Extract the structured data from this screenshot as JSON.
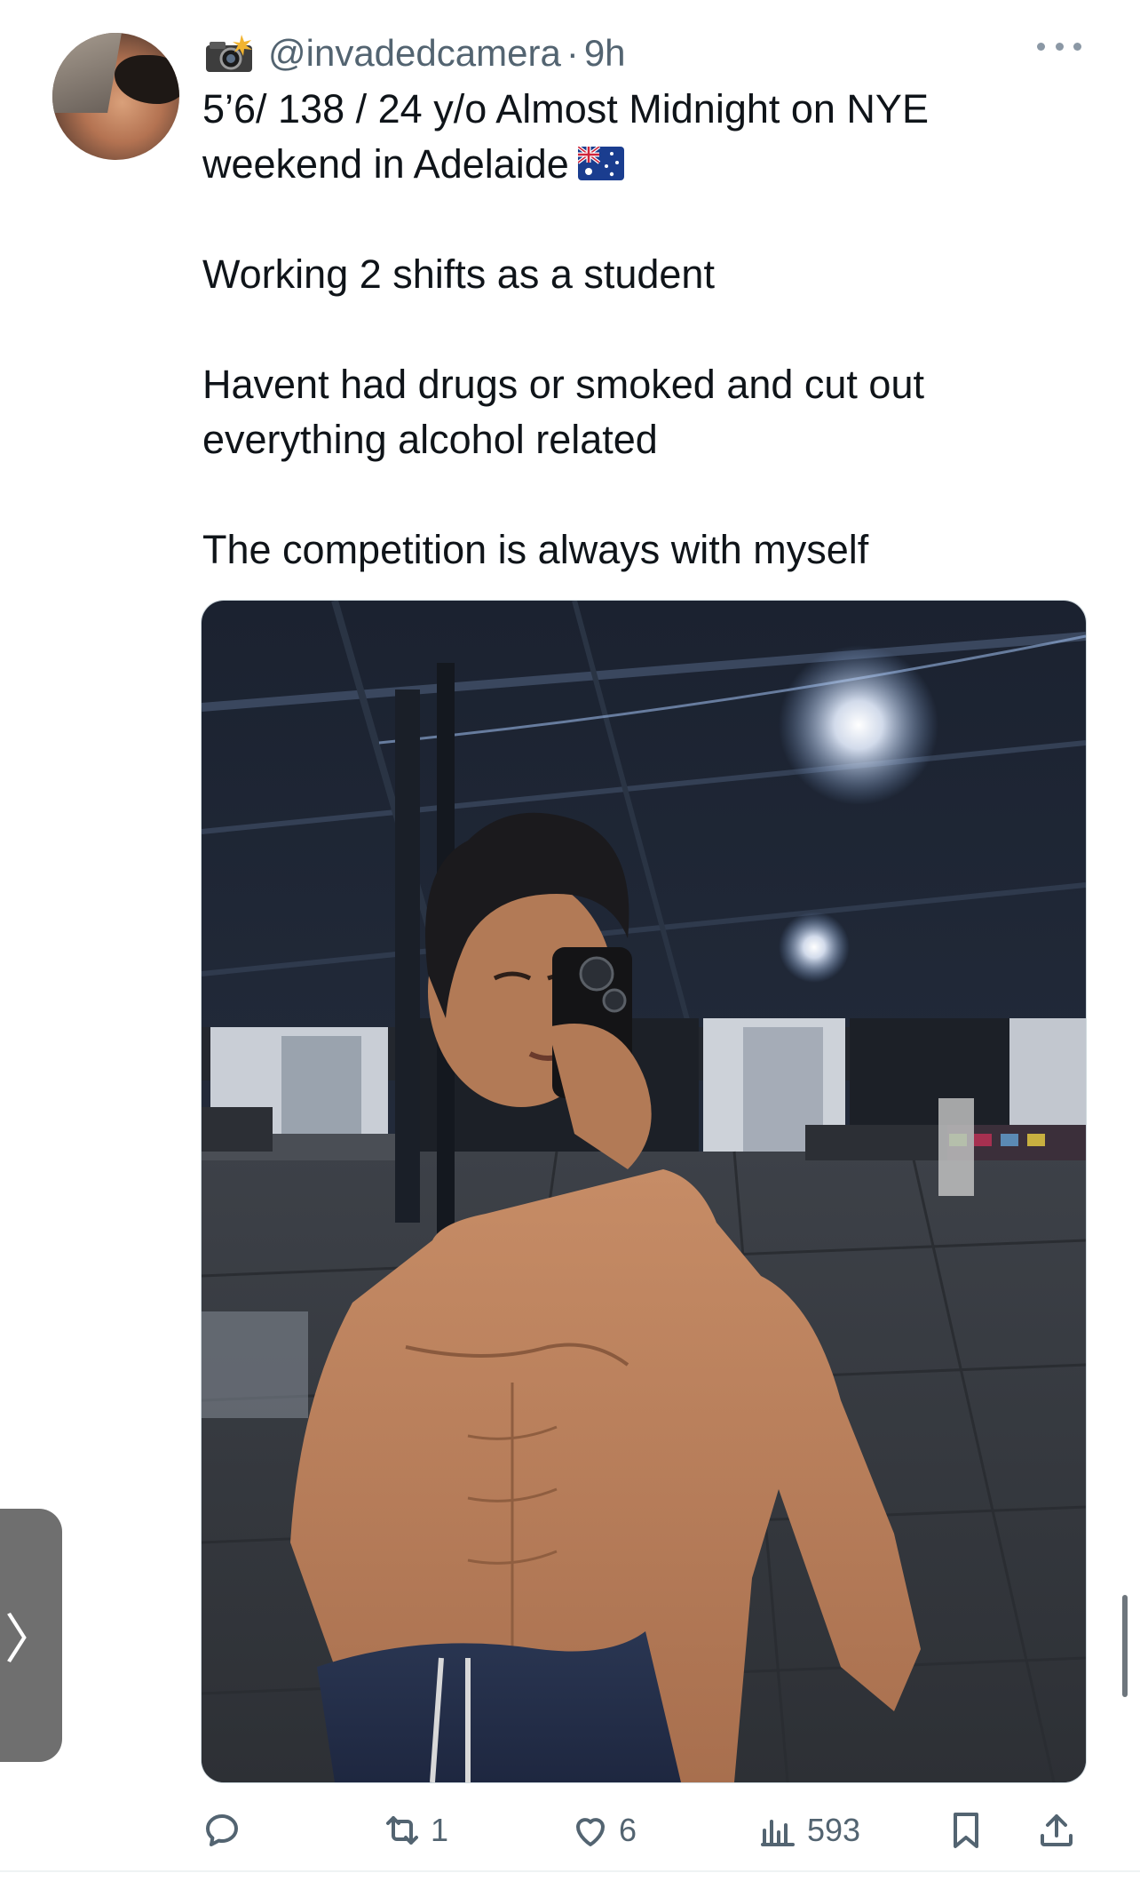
{
  "tweet": {
    "handle": "@invadedcamera",
    "separator": "·",
    "time": "9h",
    "lines": [
      "5’6/ 138 / 24 y/o Almost Midnight on NYE",
      "weekend in Adelaide",
      "Working 2 shifts as a student",
      "Havent had drugs or smoked and cut out",
      "everything alcohol related",
      "The competition is always with myself"
    ],
    "flag_emoji": "australia-flag",
    "header_emoji": "camera-with-flash"
  },
  "actions": {
    "replies": "",
    "retweets": "1",
    "likes": "6",
    "views": "593"
  },
  "side_tab": {
    "label": "〉"
  },
  "colors": {
    "text": "#0f1419",
    "secondary": "#536471",
    "border": "#cfd9de"
  }
}
